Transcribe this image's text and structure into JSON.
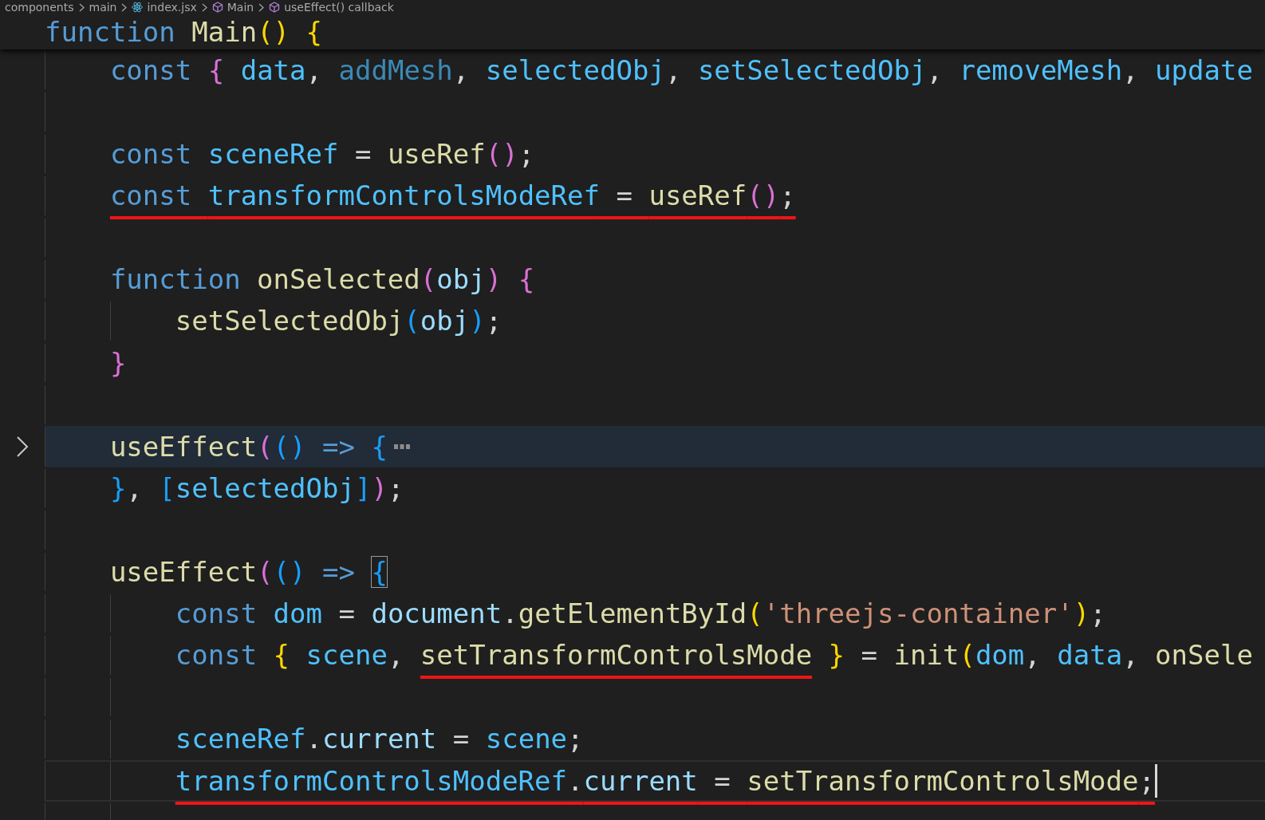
{
  "breadcrumb": [
    {
      "label": "components",
      "kind": "folder"
    },
    {
      "label": "main",
      "kind": "folder"
    },
    {
      "label": "index.jsx",
      "kind": "file"
    },
    {
      "label": "Main",
      "kind": "symbol"
    },
    {
      "label": "useEffect() callback",
      "kind": "symbol"
    }
  ],
  "sticky_scroll": {
    "tokens": [
      {
        "text": "function ",
        "kind": "keyword"
      },
      {
        "text": "Main",
        "kind": "function"
      },
      {
        "text": "() ",
        "kind": "bracket1"
      },
      {
        "text": "{",
        "kind": "bracket1"
      }
    ]
  },
  "code": [
    {
      "kind": "code",
      "tokens": [
        {
          "text": "const ",
          "kind": "keyword"
        },
        {
          "text": "{ ",
          "kind": "bracket2"
        },
        {
          "text": "data",
          "kind": "constant"
        },
        {
          "text": ", ",
          "kind": "punctuation"
        },
        {
          "text": "addMesh",
          "kind": "unused"
        },
        {
          "text": ", ",
          "kind": "punctuation"
        },
        {
          "text": "selectedObj",
          "kind": "constant"
        },
        {
          "text": ", ",
          "kind": "punctuation"
        },
        {
          "text": "setSelectedObj",
          "kind": "constant"
        },
        {
          "text": ", ",
          "kind": "punctuation"
        },
        {
          "text": "removeMesh",
          "kind": "constant"
        },
        {
          "text": ", ",
          "kind": "punctuation"
        },
        {
          "text": "update",
          "kind": "constant"
        }
      ]
    },
    {
      "kind": "blank"
    },
    {
      "kind": "code",
      "tokens": [
        {
          "text": "const ",
          "kind": "keyword"
        },
        {
          "text": "sceneRef",
          "kind": "constant"
        },
        {
          "text": " = ",
          "kind": "punctuation"
        },
        {
          "text": "useRef",
          "kind": "function"
        },
        {
          "text": "()",
          "kind": "bracket2"
        },
        {
          "text": ";",
          "kind": "punctuation"
        }
      ]
    },
    {
      "kind": "code",
      "tokens": [
        {
          "text": "const ",
          "kind": "keyword",
          "underlined": true
        },
        {
          "text": "transformControlsModeRef",
          "kind": "constant",
          "underlined": true
        },
        {
          "text": " = ",
          "kind": "punctuation",
          "underlined": true
        },
        {
          "text": "useRef",
          "kind": "function",
          "underlined": true
        },
        {
          "text": "()",
          "kind": "bracket2",
          "underlined": true
        },
        {
          "text": ";",
          "kind": "punctuation",
          "underlined": true
        }
      ]
    },
    {
      "kind": "blank"
    },
    {
      "kind": "code",
      "collapsed": false,
      "tokens": [
        {
          "text": "function ",
          "kind": "keyword"
        },
        {
          "text": "onSelected",
          "kind": "function"
        },
        {
          "text": "(",
          "kind": "bracket2"
        },
        {
          "text": "obj",
          "kind": "variable"
        },
        {
          "text": ") ",
          "kind": "bracket2"
        },
        {
          "text": "{",
          "kind": "bracket2"
        }
      ],
      "children": [
        {
          "kind": "code",
          "tokens": [
            {
              "text": "setSelectedObj",
              "kind": "function"
            },
            {
              "text": "(",
              "kind": "bracket3"
            },
            {
              "text": "obj",
              "kind": "variable"
            },
            {
              "text": ")",
              "kind": "bracket3"
            },
            {
              "text": ";",
              "kind": "punctuation"
            }
          ]
        }
      ]
    },
    {
      "kind": "code",
      "tokens": [
        {
          "text": "}",
          "kind": "bracket2"
        }
      ]
    },
    {
      "kind": "blank"
    },
    {
      "kind": "code",
      "collapsed": true,
      "tokens": [
        {
          "text": "useEffect",
          "kind": "function"
        },
        {
          "text": "(",
          "kind": "bracket2"
        },
        {
          "text": "() ",
          "kind": "bracket3"
        },
        {
          "text": "=> ",
          "kind": "keyword"
        },
        {
          "text": "{",
          "kind": "bracket3"
        }
      ]
    },
    {
      "kind": "code",
      "tokens": [
        {
          "text": "}",
          "kind": "bracket3"
        },
        {
          "text": ", ",
          "kind": "punctuation"
        },
        {
          "text": "[",
          "kind": "bracket3"
        },
        {
          "text": "selectedObj",
          "kind": "constant"
        },
        {
          "text": "]",
          "kind": "bracket3"
        },
        {
          "text": ")",
          "kind": "bracket2"
        },
        {
          "text": ";",
          "kind": "punctuation"
        }
      ]
    },
    {
      "kind": "blank"
    },
    {
      "kind": "code",
      "collapsed": false,
      "tokens": [
        {
          "text": "useEffect",
          "kind": "function"
        },
        {
          "text": "(",
          "kind": "bracket2"
        },
        {
          "text": "() ",
          "kind": "bracket3"
        },
        {
          "text": "=> ",
          "kind": "keyword"
        },
        {
          "text": "{",
          "kind": "bracket3",
          "bracket_match": true
        }
      ],
      "children": [
        {
          "kind": "code",
          "tokens": [
            {
              "text": "const ",
              "kind": "keyword"
            },
            {
              "text": "dom",
              "kind": "constant"
            },
            {
              "text": " = ",
              "kind": "punctuation"
            },
            {
              "text": "document",
              "kind": "variable"
            },
            {
              "text": ".",
              "kind": "punctuation"
            },
            {
              "text": "getElementById",
              "kind": "function"
            },
            {
              "text": "(",
              "kind": "bracket1"
            },
            {
              "text": "'threejs-container'",
              "kind": "string"
            },
            {
              "text": ")",
              "kind": "bracket1"
            },
            {
              "text": ";",
              "kind": "punctuation"
            }
          ]
        },
        {
          "kind": "code",
          "tokens": [
            {
              "text": "const ",
              "kind": "keyword"
            },
            {
              "text": "{ ",
              "kind": "bracket1"
            },
            {
              "text": "scene",
              "kind": "constant"
            },
            {
              "text": ", ",
              "kind": "punctuation"
            },
            {
              "text": "setTransformControlsMode",
              "kind": "function",
              "underlined": true
            },
            {
              "text": " }",
              "kind": "bracket1"
            },
            {
              "text": " = ",
              "kind": "punctuation"
            },
            {
              "text": "init",
              "kind": "function"
            },
            {
              "text": "(",
              "kind": "bracket1"
            },
            {
              "text": "dom",
              "kind": "constant"
            },
            {
              "text": ", ",
              "kind": "punctuation"
            },
            {
              "text": "data",
              "kind": "constant"
            },
            {
              "text": ", ",
              "kind": "punctuation"
            },
            {
              "text": "onSele",
              "kind": "function"
            }
          ]
        },
        {
          "kind": "blank"
        },
        {
          "kind": "code",
          "tokens": [
            {
              "text": "sceneRef",
              "kind": "constant"
            },
            {
              "text": ".",
              "kind": "punctuation"
            },
            {
              "text": "current",
              "kind": "variable"
            },
            {
              "text": " = ",
              "kind": "punctuation"
            },
            {
              "text": "scene",
              "kind": "constant"
            },
            {
              "text": ";",
              "kind": "punctuation"
            }
          ]
        },
        {
          "kind": "code",
          "current": true,
          "tokens": [
            {
              "text": "transformControlsModeRef",
              "kind": "constant",
              "underlined": true
            },
            {
              "text": ".",
              "kind": "punctuation",
              "underlined": true
            },
            {
              "text": "current",
              "kind": "variable",
              "underlined": true
            },
            {
              "text": " = ",
              "kind": "punctuation",
              "underlined": true
            },
            {
              "text": "setTransformControlsMode",
              "kind": "function",
              "underlined": true
            },
            {
              "text": ";",
              "kind": "punctuation",
              "underlined": true
            }
          ]
        },
        {
          "kind": "blank"
        }
      ]
    }
  ]
}
